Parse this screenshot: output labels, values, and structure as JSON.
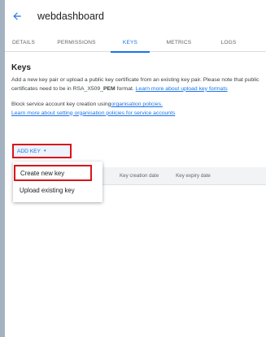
{
  "header": {
    "title": "webdashboard"
  },
  "tabs": [
    {
      "label": "DETAILS"
    },
    {
      "label": "PERMISSIONS"
    },
    {
      "label": "KEYS"
    },
    {
      "label": "METRICS"
    },
    {
      "label": "LOGS"
    }
  ],
  "keys": {
    "heading": "Keys",
    "para1_text": "Add a new key pair or upload a public key certificate from an existing key pair. Please note that public certificates need to be in RSA_X509_",
    "para1_bold": "PEM",
    "para1_text2": " format.",
    "para1_link": "Learn more about upload key formats",
    "para2_text": "Block service account key creation using",
    "para2_link": "organisation policies.",
    "para2_link2": "Learn more about setting organisation policies for service accounts"
  },
  "add_key": {
    "label": "ADD KEY",
    "caret": "▾"
  },
  "menu": {
    "items": [
      {
        "label": "Create new key"
      },
      {
        "label": "Upload existing key"
      }
    ]
  },
  "table": {
    "columns": [
      "Key creation date",
      "Key expiry date"
    ]
  },
  "colors": {
    "accent": "#1a73e8",
    "highlight": "#d9131b"
  }
}
